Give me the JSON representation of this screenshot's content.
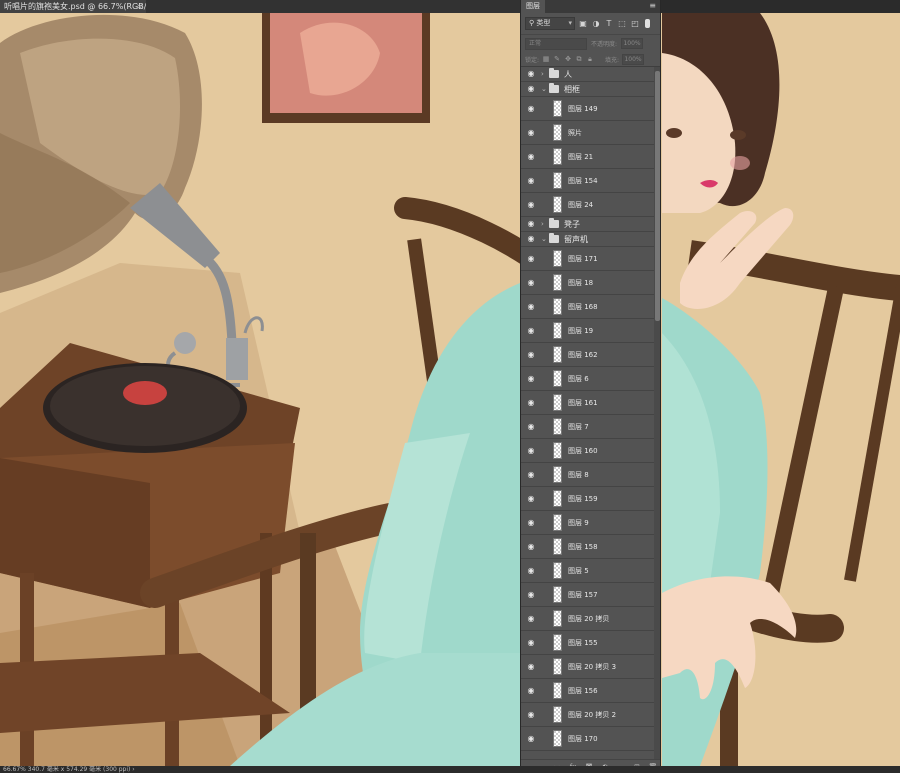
{
  "document": {
    "tab_title": "听唱片的旗袍美女.psd @ 66.7%(RGB/8) *",
    "close_glyph": "×"
  },
  "status": {
    "text": "66.67%   340.7 毫米 x 574.29 毫米 (300 ppi)   ›"
  },
  "layers_panel": {
    "tab_label": "图层",
    "menu_glyph": "≡",
    "filter": {
      "kind_label": "类型",
      "icons": [
        "image-filter-icon",
        "adjustment-filter-icon",
        "type-filter-icon",
        "shape-filter-icon",
        "smart-object-filter-icon"
      ]
    },
    "blend_mode": "正常",
    "opacity_label": "不透明度:",
    "opacity_value": "100%",
    "lock_label": "锁定:",
    "fill_label": "填充:",
    "fill_value": "100%",
    "layers": [
      {
        "type": "group",
        "name": "人",
        "expanded": false
      },
      {
        "type": "group",
        "name": "相框",
        "expanded": true
      },
      {
        "type": "layer",
        "name": "图层 149"
      },
      {
        "type": "layer",
        "name": "照片"
      },
      {
        "type": "layer",
        "name": "图层 21"
      },
      {
        "type": "layer",
        "name": "图层 154"
      },
      {
        "type": "layer",
        "name": "图层 24"
      },
      {
        "type": "group",
        "name": "凳子",
        "expanded": false
      },
      {
        "type": "group",
        "name": "留声机",
        "expanded": true
      },
      {
        "type": "layer",
        "name": "图层 171"
      },
      {
        "type": "layer",
        "name": "图层 18"
      },
      {
        "type": "layer",
        "name": "图层 168"
      },
      {
        "type": "layer",
        "name": "图层 19"
      },
      {
        "type": "layer",
        "name": "图层 162"
      },
      {
        "type": "layer",
        "name": "图层 6"
      },
      {
        "type": "layer",
        "name": "图层 161"
      },
      {
        "type": "layer",
        "name": "图层 7"
      },
      {
        "type": "layer",
        "name": "图层 160"
      },
      {
        "type": "layer",
        "name": "图层 8"
      },
      {
        "type": "layer",
        "name": "图层 159"
      },
      {
        "type": "layer",
        "name": "图层 9"
      },
      {
        "type": "layer",
        "name": "图层 158"
      },
      {
        "type": "layer",
        "name": "图层 5"
      },
      {
        "type": "layer",
        "name": "图层 157"
      },
      {
        "type": "layer",
        "name": "图层 20 拷贝"
      },
      {
        "type": "layer",
        "name": "图层 155"
      },
      {
        "type": "layer",
        "name": "图层 20 拷贝 3"
      },
      {
        "type": "layer",
        "name": "图层 156"
      },
      {
        "type": "layer",
        "name": "图层 20 拷贝 2"
      },
      {
        "type": "layer",
        "name": "图层 170"
      }
    ],
    "footer_icons": [
      "link-icon",
      "fx-icon",
      "mask-icon",
      "adjustment-icon",
      "new-group-icon",
      "new-layer-icon",
      "delete-icon"
    ]
  },
  "colors": {
    "wall": "#e9cfa4",
    "dress": "#9fd9cb",
    "wood": "#5a3a22",
    "panel": "#535353"
  }
}
